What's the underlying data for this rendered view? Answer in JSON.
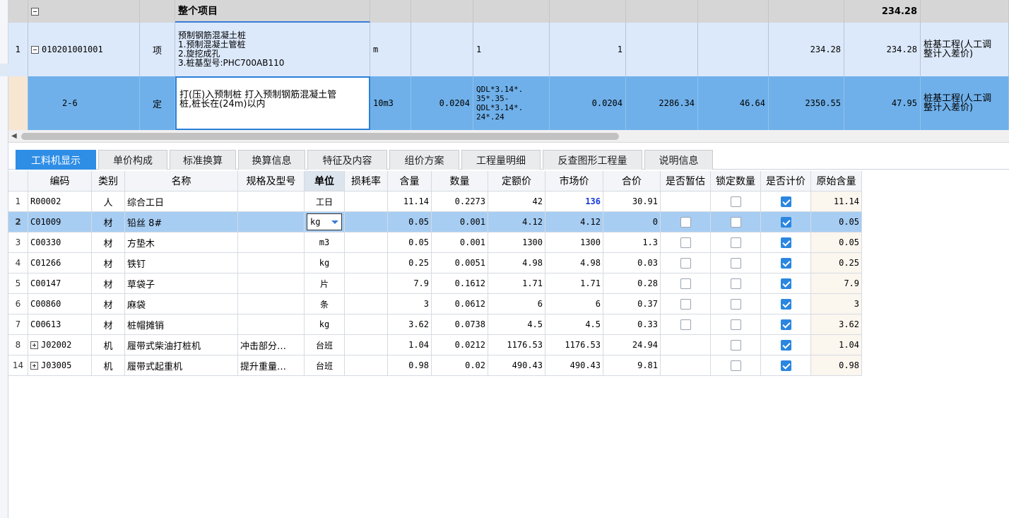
{
  "top_grid": {
    "group_row": {
      "name": "整个项目",
      "total": "234.28"
    },
    "item_row": {
      "seq": "1",
      "code": "010201001001",
      "category": "项",
      "name": "预制钢筋混凝土桩\n1.预制混凝土管桩\n2.旋挖成孔\n3.桩基型号:PHC700AB110",
      "unit": "m",
      "expr": "1",
      "qty": "1",
      "total_a": "234.28",
      "total_b": "234.28",
      "remark": "桩基工程(人工调\n整计入差价)"
    },
    "sub_row": {
      "code": "2-6",
      "category": "定",
      "name": "打(压)入预制桩 打入预制钢筋混凝土管\n桩,桩长在(24m)以内",
      "unit": "10m3",
      "content": "0.0204",
      "expr": "QDL*3.14*.\n35*.35-\nQDL*3.14*.\n24*.24",
      "qty": "0.0204",
      "price1": "2286.34",
      "price2": "46.64",
      "price3": "2350.55",
      "price4": "47.95",
      "remark": "桩基工程(人工调\n整计入差价)"
    }
  },
  "tabs": [
    "工料机显示",
    "单价构成",
    "标准换算",
    "换算信息",
    "特征及内容",
    "组价方案",
    "工程量明细",
    "反查图形工程量",
    "说明信息"
  ],
  "active_tab": "工料机显示",
  "table": {
    "headers": [
      "编码",
      "类别",
      "名称",
      "规格及型号",
      "单位",
      "损耗率",
      "含量",
      "数量",
      "定额价",
      "市场价",
      "合价",
      "是否暂估",
      "锁定数量",
      "是否计价",
      "原始含量"
    ],
    "rows": [
      {
        "no": "1",
        "code": "R00002",
        "type": "人",
        "name": "综合工日",
        "spec": "",
        "unit": "工日",
        "loss": "",
        "content": "11.14",
        "qty": "0.2273",
        "quota": "42",
        "market": "136",
        "total": "30.91",
        "est": null,
        "lock": false,
        "priced": true,
        "orig": "11.14",
        "expand": false
      },
      {
        "no": "2",
        "code": "C01009",
        "type": "材",
        "name": "铅丝 8#",
        "spec": "",
        "unit": "kg",
        "loss": "",
        "content": "0.05",
        "qty": "0.001",
        "quota": "4.12",
        "market": "4.12",
        "total": "0",
        "est": false,
        "lock": false,
        "priced": true,
        "orig": "0.05",
        "expand": false
      },
      {
        "no": "3",
        "code": "C00330",
        "type": "材",
        "name": "方垫木",
        "spec": "",
        "unit": "m3",
        "loss": "",
        "content": "0.05",
        "qty": "0.001",
        "quota": "1300",
        "market": "1300",
        "total": "1.3",
        "est": false,
        "lock": false,
        "priced": true,
        "orig": "0.05",
        "expand": false
      },
      {
        "no": "4",
        "code": "C01266",
        "type": "材",
        "name": "铁钉",
        "spec": "",
        "unit": "kg",
        "loss": "",
        "content": "0.25",
        "qty": "0.0051",
        "quota": "4.98",
        "market": "4.98",
        "total": "0.03",
        "est": false,
        "lock": false,
        "priced": true,
        "orig": "0.25",
        "expand": false
      },
      {
        "no": "5",
        "code": "C00147",
        "type": "材",
        "name": "草袋子",
        "spec": "",
        "unit": "片",
        "loss": "",
        "content": "7.9",
        "qty": "0.1612",
        "quota": "1.71",
        "market": "1.71",
        "total": "0.28",
        "est": false,
        "lock": false,
        "priced": true,
        "orig": "7.9",
        "expand": false
      },
      {
        "no": "6",
        "code": "C00860",
        "type": "材",
        "name": "麻袋",
        "spec": "",
        "unit": "条",
        "loss": "",
        "content": "3",
        "qty": "0.0612",
        "quota": "6",
        "market": "6",
        "total": "0.37",
        "est": false,
        "lock": false,
        "priced": true,
        "orig": "3",
        "expand": false
      },
      {
        "no": "7",
        "code": "C00613",
        "type": "材",
        "name": "桩帽摊销",
        "spec": "",
        "unit": "kg",
        "loss": "",
        "content": "3.62",
        "qty": "0.0738",
        "quota": "4.5",
        "market": "4.5",
        "total": "0.33",
        "est": false,
        "lock": false,
        "priced": true,
        "orig": "3.62",
        "expand": false
      },
      {
        "no": "8",
        "code": "J02002",
        "type": "机",
        "name": "履带式柴油打桩机",
        "spec": "冲击部分…",
        "unit": "台班",
        "loss": "",
        "content": "1.04",
        "qty": "0.0212",
        "quota": "1176.53",
        "market": "1176.53",
        "total": "24.94",
        "est": null,
        "lock": false,
        "priced": true,
        "orig": "1.04",
        "expand": true
      },
      {
        "no": "14",
        "code": "J03005",
        "type": "机",
        "name": "履带式起重机",
        "spec": "提升重量…",
        "unit": "台班",
        "loss": "",
        "content": "0.98",
        "qty": "0.02",
        "quota": "490.43",
        "market": "490.43",
        "total": "9.81",
        "est": null,
        "lock": false,
        "priced": true,
        "orig": "0.98",
        "expand": true
      }
    ],
    "selected_row": "2",
    "sorted_column": "单位"
  },
  "colors": {
    "accent": "#2e8ee6",
    "selected_row": "#a7cdf3",
    "sub_row": "#6fb0ea",
    "market_highlight": "#1a3ad8"
  }
}
